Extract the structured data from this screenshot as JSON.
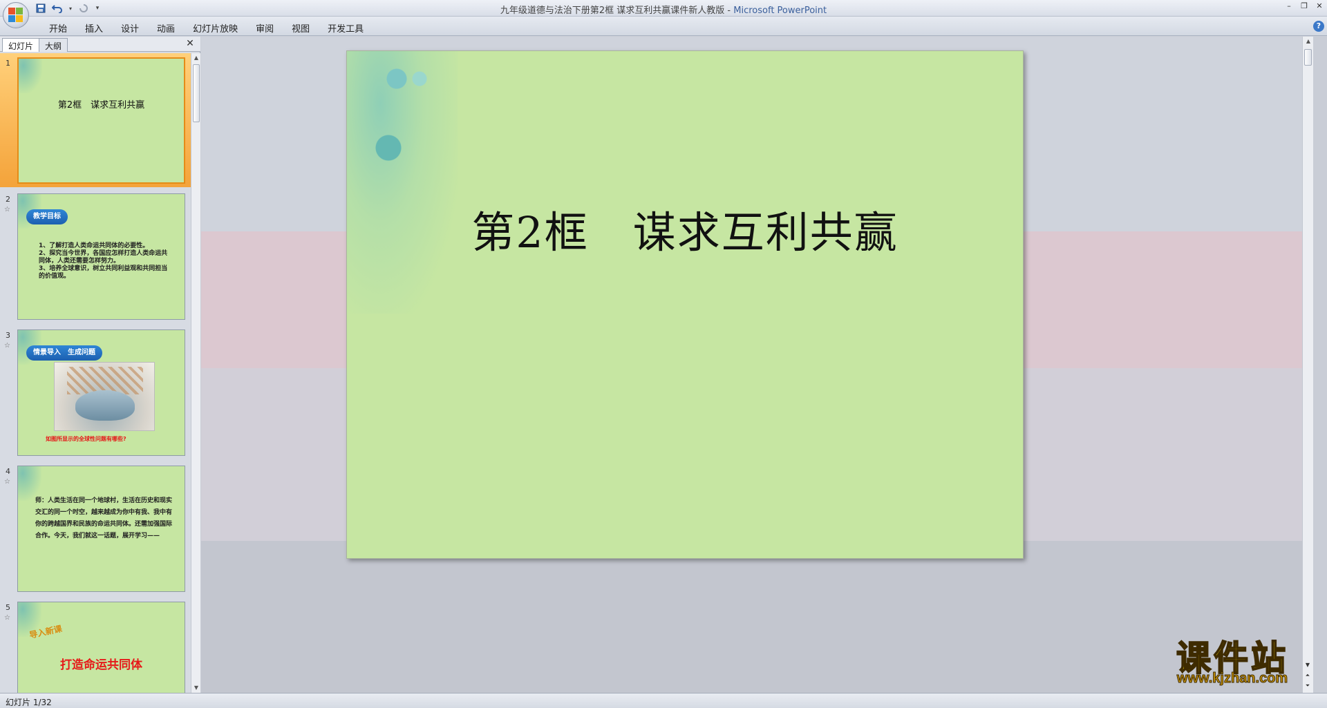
{
  "window": {
    "title": "九年级道德与法治下册第2框 谋求互利共赢课件新人教版",
    "app_name": "Microsoft PowerPoint"
  },
  "ribbon": {
    "tabs": [
      "开始",
      "插入",
      "设计",
      "动画",
      "幻灯片放映",
      "审阅",
      "视图",
      "开发工具"
    ]
  },
  "left_pane": {
    "tabs": {
      "slides": "幻灯片",
      "outline": "大纲"
    },
    "thumbnails": [
      {
        "number": "1",
        "title": "第2框　谋求互利共赢"
      },
      {
        "number": "2",
        "pill": "教学目标",
        "lines": [
          "1、了解打造人类命运共同体的必要性。",
          "2、探究当今世界，各国应怎样打造人类命运共同体，人类还需要怎样努力。",
          "3、培养全球意识，树立共同利益观和共同担当的价值观。"
        ]
      },
      {
        "number": "3",
        "pill": "情景导入　生成问题",
        "caption": "如图所显示的全球性问题有哪些?"
      },
      {
        "number": "4",
        "text": "师：人类生活在同一个地球村，生活在历史和现实交汇的同一个时空，越来越成为你中有我、我中有你的跨越国界和民族的命运共同体。还需加强国际合作。今天，我们就这一话题，展开学习——"
      },
      {
        "number": "5",
        "wordart": "导入新课",
        "title": "打造命运共同体"
      }
    ]
  },
  "slide": {
    "title": "第2框　谋求互利共赢"
  },
  "watermark": {
    "top": "课件站",
    "bottom": "www.kjzhan.com"
  },
  "status": {
    "slide_counter": "幻灯片 1/32"
  },
  "colors": {
    "slide_bg": "#c6e6a2",
    "selected_thumb": "#f4a33a",
    "pill_blue": "#1c5fb0",
    "red_text": "#e61919"
  }
}
